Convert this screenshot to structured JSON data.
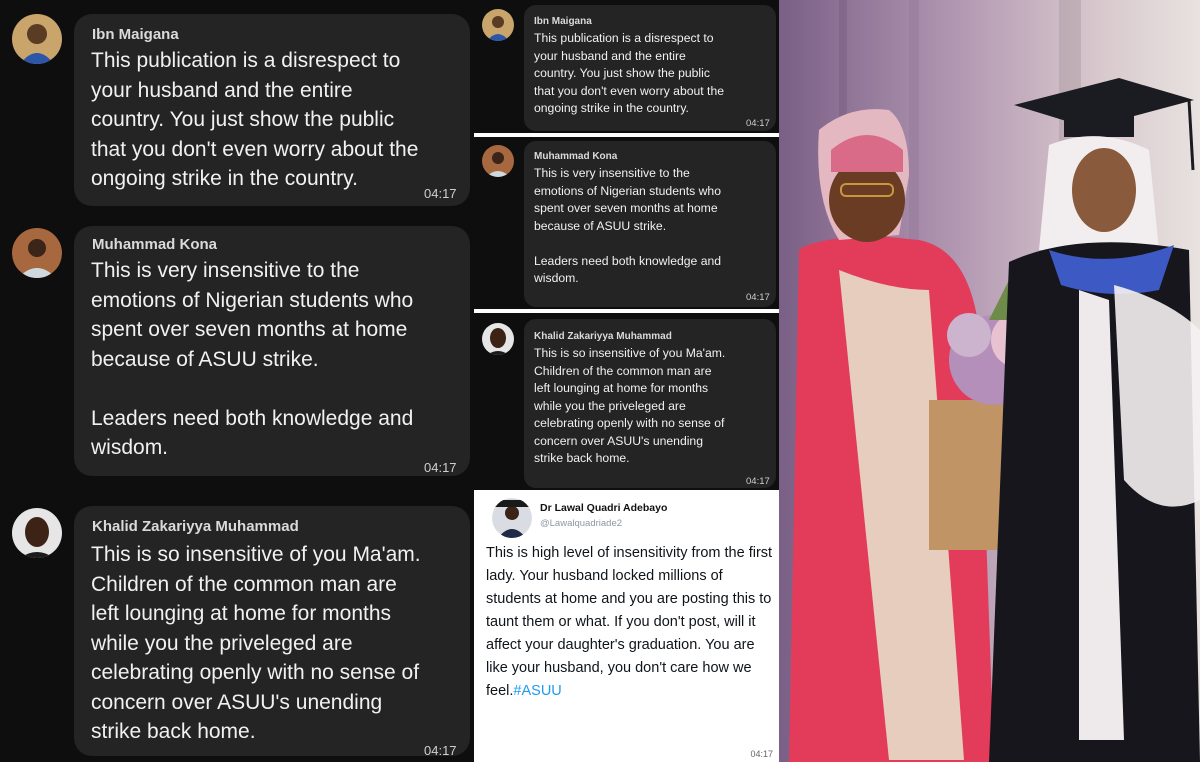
{
  "left_pane": {
    "comments": [
      {
        "author": "Ibn Maigana",
        "text": "This publication is a disrespect to\nyour husband and the entire\ncountry. You just show the public\nthat you don't even worry about the\nongoing strike in the country.",
        "time": "04:17"
      },
      {
        "author": "Muhammad Kona",
        "text": "This is very insensitive to the\nemotions of Nigerian students who\nspent over seven months at home\nbecause of ASUU strike.\n\nLeaders need both knowledge and\nwisdom.",
        "time": "04:17"
      },
      {
        "author": "Khalid Zakariyya Muhammad",
        "text": "This is so insensitive of you Ma'am.\nChildren of the common man are\nleft lounging at home for months\nwhile you the priveleged are\ncelebrating openly with no sense of\nconcern over ASUU's unending\nstrike back home.",
        "time": "04:17"
      }
    ]
  },
  "middle_pane": {
    "comments": [
      {
        "author": "Ibn Maigana",
        "text": "This publication is a disrespect to\nyour husband and the entire\ncountry. You just show the public\nthat you don't even worry about the\nongoing strike in the country.",
        "time": "04:17"
      },
      {
        "author": "Muhammad Kona",
        "text": "This is very insensitive to the\nemotions of Nigerian students who\nspent over seven months at home\nbecause of ASUU strike.\n\nLeaders need both knowledge and\nwisdom.",
        "time": "04:17"
      },
      {
        "author": "Khalid Zakariyya Muhammad",
        "text": "This is so insensitive of you Ma'am.\nChildren of the common man are\nleft lounging at home for months\nwhile you the priveleged are\ncelebrating openly with no sense of\nconcern over ASUU's unending\nstrike back home.",
        "time": "04:17"
      }
    ]
  },
  "tweet": {
    "name": "Dr Lawal Quadri Adebayo",
    "handle": "@Lawalquadriade2",
    "text": "This is high level of insensitivity from the first lady. Your husband locked millions of students at home and you are posting this to taunt them or what. If you don't post, will it affect your daughter's graduation. You are like your husband, you don't care how we feel.",
    "hashtag": "#ASUU",
    "time": "04:17"
  },
  "photo": {
    "icon": "graduation-photo-image"
  }
}
